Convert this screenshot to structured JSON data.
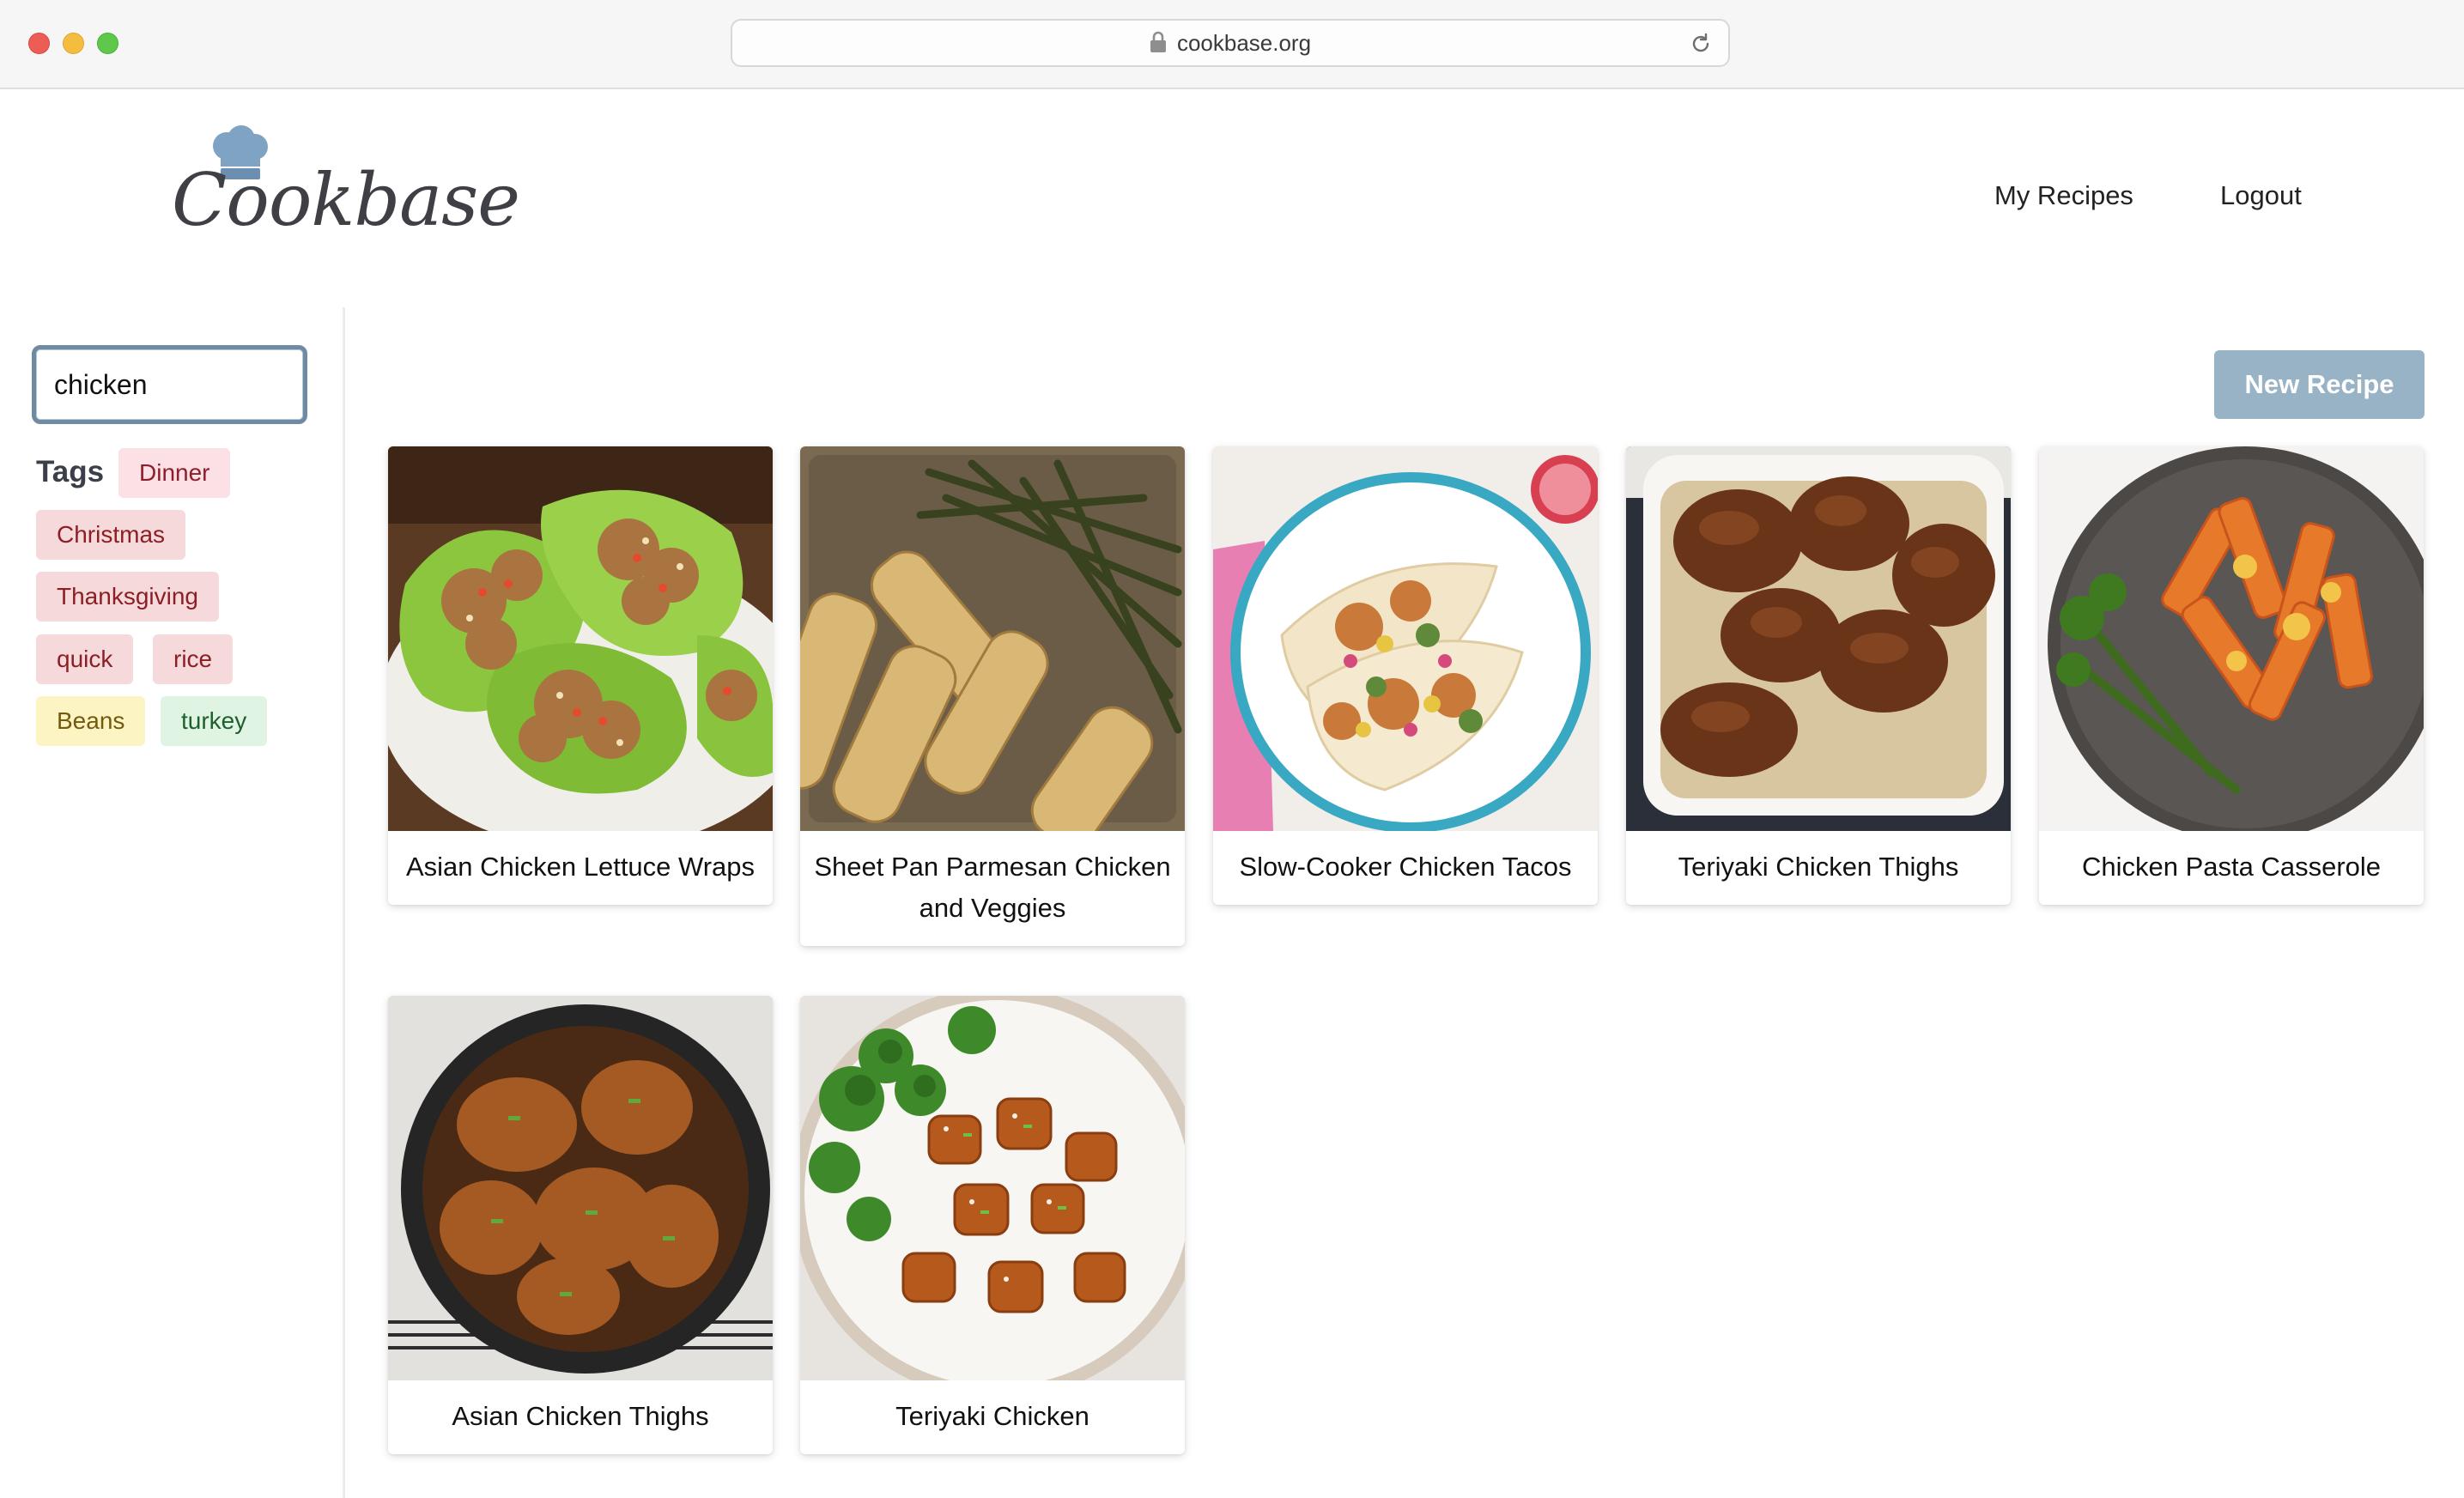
{
  "browser": {
    "url": "cookbase.org"
  },
  "header": {
    "logo_text": "Cookbase",
    "nav": {
      "my_recipes": "My Recipes",
      "logout": "Logout"
    }
  },
  "sidebar": {
    "search_value": "chicken",
    "tags_label": "Tags",
    "tags": [
      {
        "label": "Dinner",
        "color": "#fbe1e6"
      },
      {
        "label": "Christmas",
        "color": "#f6dadb"
      },
      {
        "label": "Thanksgiving",
        "color": "#f6dadb"
      },
      {
        "label": "quick",
        "color": "#f6dadb"
      },
      {
        "label": "rice",
        "color": "#f6dadb"
      },
      {
        "label": "Beans",
        "color": "#fdf4c4"
      },
      {
        "label": "turkey",
        "color": "#dff4e3"
      }
    ]
  },
  "main": {
    "new_recipe_label": "New Recipe",
    "recipes": [
      {
        "title": "Asian Chicken Lettuce Wraps",
        "image": "lettuce-wraps"
      },
      {
        "title": "Sheet Pan Parmesan Chicken and Veggies",
        "image": "sheet-pan-chicken"
      },
      {
        "title": "Slow-Cooker Chicken Tacos",
        "image": "chicken-tacos"
      },
      {
        "title": "Teriyaki Chicken Thighs",
        "image": "teriyaki-thighs"
      },
      {
        "title": "Chicken Pasta Casserole",
        "image": "pasta-casserole"
      },
      {
        "title": "Asian Chicken Thighs",
        "image": "asian-thighs"
      },
      {
        "title": "Teriyaki Chicken",
        "image": "teriyaki-chicken"
      }
    ]
  },
  "colors": {
    "accent": "#98b2c6",
    "search_border": "#6f8aa3"
  }
}
